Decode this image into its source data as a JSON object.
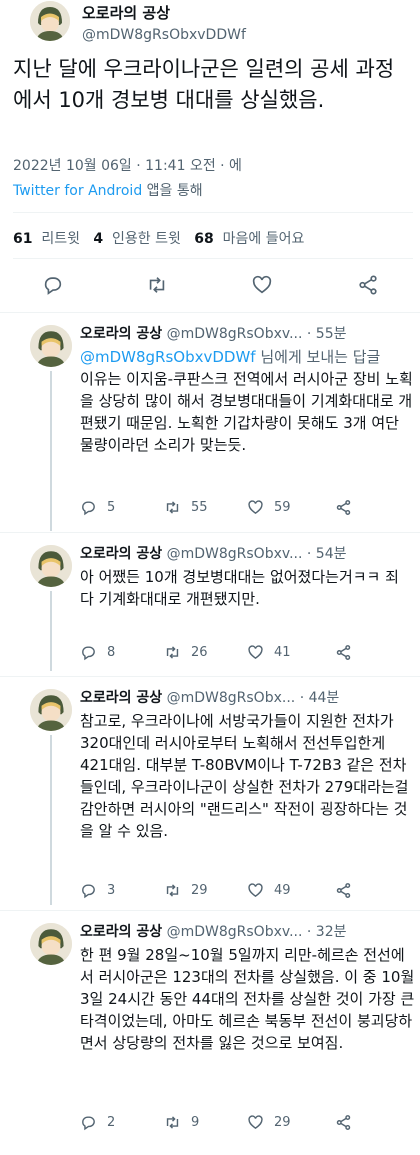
{
  "main": {
    "name": "오로라의 공상",
    "handle": "@mDW8gRsObxvDDWf",
    "text": "지난 달에 우크라이나군은 일련의 공세 과정에서 10개 경보병 대대를 상실했음.",
    "timestamp": "2022년 10월 06일 · 11:41 오전 · 에",
    "source_app": "Twitter for Android",
    "source_suffix": " 앱을 통해",
    "stats": {
      "retweets": "61",
      "retweets_label": "리트윗",
      "quotes": "4",
      "quotes_label": "인용한 트윗",
      "likes": "68",
      "likes_label": "마음에 들어요"
    },
    "icons": [
      "reply-icon",
      "retweet-icon",
      "like-icon",
      "share-icon"
    ]
  },
  "replies": [
    {
      "name": "오로라의 공상",
      "handle": "@mDW8gRsObxv...",
      "time": "55분",
      "replying_to": "@mDW8gRsObxvDDWf",
      "replying_suffix": " 님에게 보내는 답글",
      "text": "이유는 이지움-쿠판스크 전역에서 러시아군 장비 노획을 상당히 많이 해서 경보병대대들이 기계화대대로 개편됐기 때문임. 노획한 기갑차량이 못해도 3개 여단 물량이라던 소리가 맞는듯.",
      "replies": "5",
      "retweets": "55",
      "likes": "59"
    },
    {
      "name": "오로라의 공상",
      "handle": "@mDW8gRsObxv...",
      "time": "54분",
      "text": "아 어쨌든 10개 경보병대대는 없어졌다는거ㅋㅋ 죄다 기계화대대로 개편됐지만.",
      "replies": "8",
      "retweets": "26",
      "likes": "41"
    },
    {
      "name": "오로라의 공상",
      "handle": "@mDW8gRsObx...",
      "time": "44분",
      "text": "참고로, 우크라이나에 서방국가들이 지원한 전차가 320대인데 러시아로부터 노획해서 전선투입한게 421대임. 대부분 T-80BVM이나 T-72B3 같은 전차들인데, 우크라이나군이 상실한 전차가 279대라는걸 감안하면 러시아의 \"랜드리스\" 작전이 굉장하다는 것을 알 수 있음.",
      "replies": "3",
      "retweets": "29",
      "likes": "49"
    },
    {
      "name": "오로라의 공상",
      "handle": "@mDW8gRsObxv...",
      "time": "32분",
      "text": "한 편 9월 28일~10월 5일까지 리만-헤르손 전선에서 러시아군은 123대의 전차를 상실했음. 이 중 10월 3일 24시간 동안 44대의 전차를 상실한 것이 가장 큰 타격이었는데, 아마도 헤르손 북동부 전선이 붕괴당하면서 상당량의 전차를 잃은 것으로 보여짐.",
      "replies": "2",
      "retweets": "9",
      "likes": "29"
    }
  ],
  "colors": {
    "link": "#1d9bf0",
    "secondary": "#536471",
    "text": "#0f1419"
  }
}
